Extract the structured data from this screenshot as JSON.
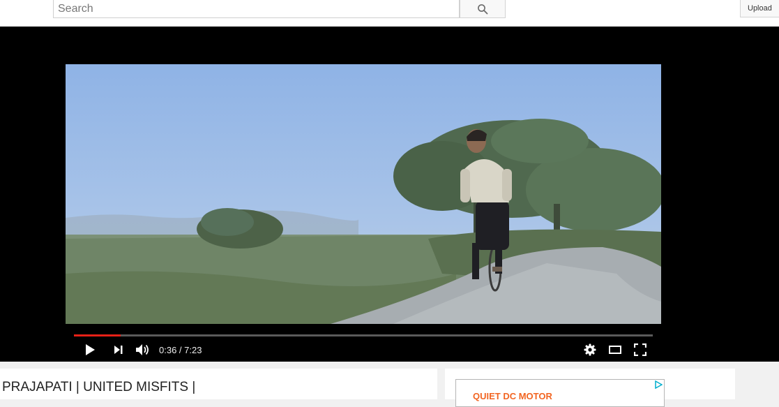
{
  "header": {
    "search_placeholder": "Search",
    "upload_label": "Upload"
  },
  "player": {
    "current_time": "0:36",
    "duration": "7:23",
    "time_display": "0:36 / 7:23",
    "progress_fraction": 0.081,
    "progress_color": "#e62117"
  },
  "video": {
    "title": "PRAJAPATI | UNITED MISFITS |"
  },
  "ad": {
    "text": "QUIET DC MOTOR",
    "accent_color": "#f26522"
  },
  "icons": [
    "search-icon",
    "play-icon",
    "next-icon",
    "volume-icon",
    "settings-gear-icon",
    "theater-mode-icon",
    "fullscreen-icon",
    "ad-choices-icon"
  ]
}
